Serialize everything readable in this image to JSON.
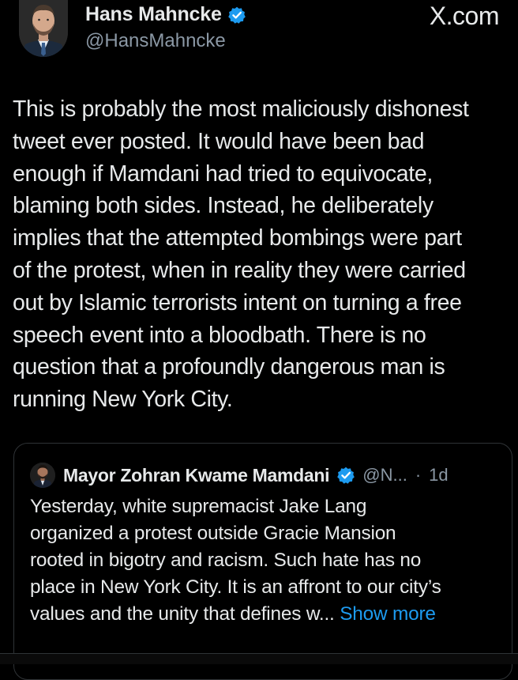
{
  "author": {
    "display_name": "Hans Mahncke",
    "handle": "@HansMahncke",
    "verified": true
  },
  "brand": "X.com",
  "tweet": {
    "lines": [
      "This is probably the most maliciously dishonest",
      "tweet ever posted. It would have been bad",
      "enough if Mamdani had tried to equivocate,",
      "blaming both sides. Instead, he deliberately",
      "implies that the attempted bombings were part",
      "of the protest, when in reality they were carried",
      "out by Islamic terrorists intent on turning a free",
      "speech event into a bloodbath. There is no",
      "question that a profoundly dangerous man is",
      "running New York City."
    ]
  },
  "quote": {
    "display_name": "Mayor Zohran Kwame Mamdani",
    "handle": "@N...",
    "separator": "·",
    "age": "1d",
    "verified": true,
    "lines": [
      "Yesterday, white supremacist Jake Lang",
      "organized a protest outside Gracie Mansion",
      "rooted in bigotry and racism. Such hate has no",
      "place in New York City. It is an affront to our city’s"
    ],
    "last_line": "values and the unity that defines w...",
    "show_more": "Show more"
  },
  "colors": {
    "background": "#000000",
    "text": "#e7e9ea",
    "secondary": "#8b98a5",
    "accent": "#1d9bf0",
    "border": "#2f3336"
  },
  "icons": {
    "verified": "verified-badge-icon",
    "brand": "x-logo"
  }
}
